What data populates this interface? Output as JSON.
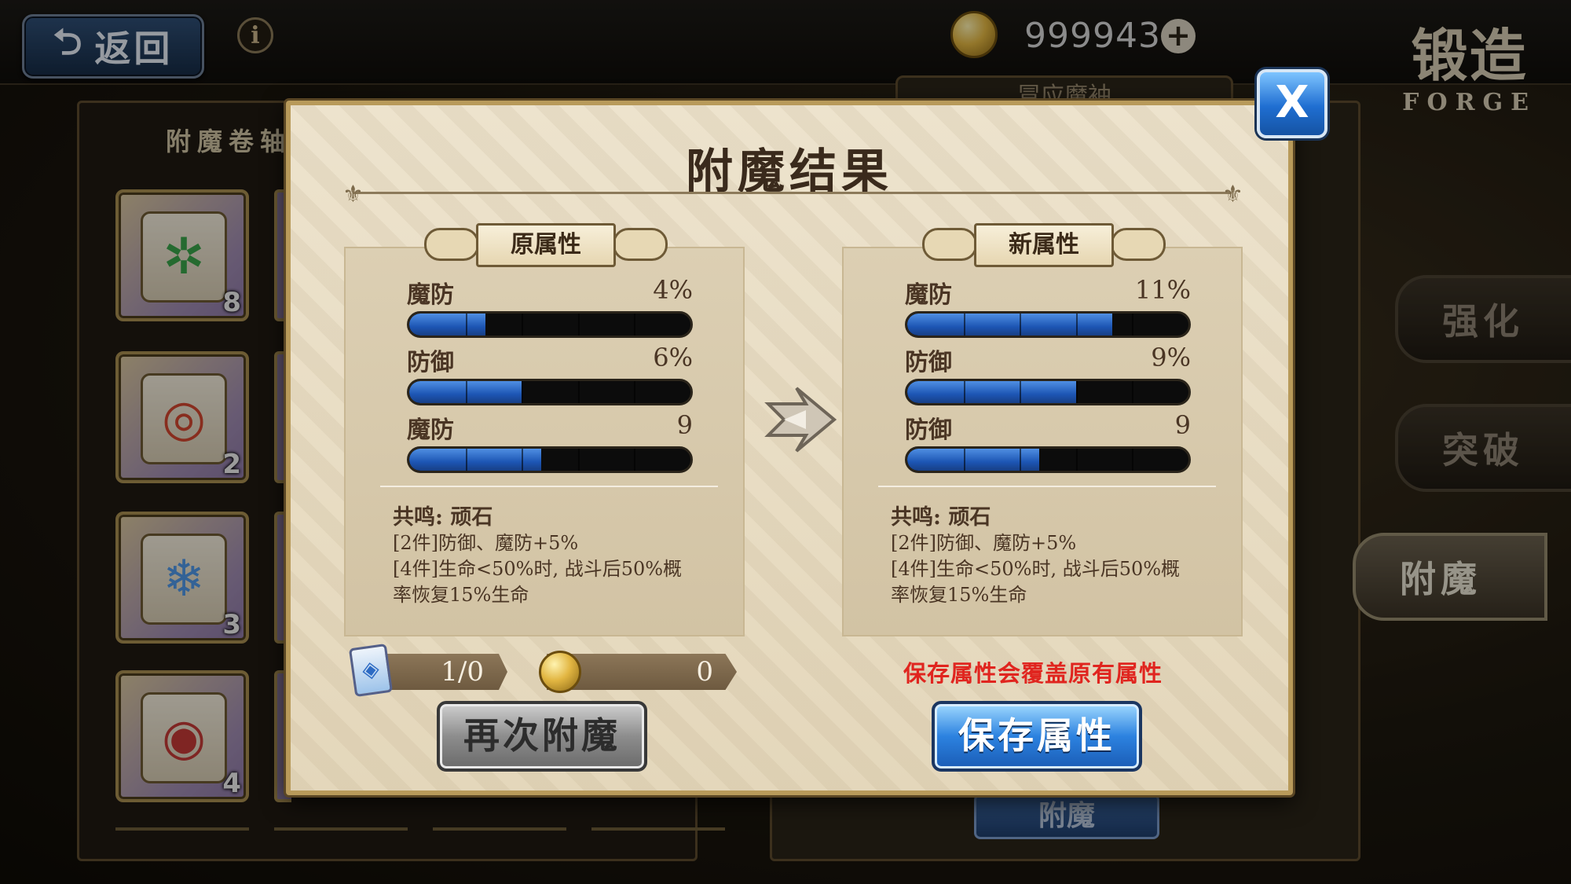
{
  "header": {
    "back_label": "返回",
    "info_icon": "i",
    "coins": "999943",
    "coin_add": "+",
    "screen_title": "锻造",
    "screen_title_en": "FORGE"
  },
  "left_panel": {
    "title": "附魔卷轴",
    "scrolls": [
      {
        "count": "8",
        "color": "#3aa34a",
        "glyph": "✲"
      },
      {
        "count": "2",
        "color": "#d2452e",
        "glyph": "◎"
      },
      {
        "count": "3",
        "color": "#4f97e6",
        "glyph": "❄"
      },
      {
        "count": "4",
        "color": "#c43a36",
        "glyph": "◉"
      }
    ]
  },
  "right_panel": {
    "tab_label": "冒应魔袖",
    "side_tabs": [
      "强化",
      "突破",
      "附魔"
    ],
    "bg_button": "附魔"
  },
  "modal": {
    "title": "附魔结果",
    "close_label": "X",
    "old": {
      "banner": "原属性",
      "stats": [
        {
          "name": "魔防",
          "value": "4%",
          "fill": 0.27
        },
        {
          "name": "防御",
          "value": "6%",
          "fill": 0.4
        },
        {
          "name": "魔防",
          "value": "9",
          "fill": 0.47
        }
      ],
      "resonance_title": "共鸣: 顽石",
      "resonance_lines": [
        "[2件]防御、魔防+5%",
        "[4件]生命<50%时, 战斗后50%概",
        "率恢复15%生命"
      ]
    },
    "new": {
      "banner": "新属性",
      "stats": [
        {
          "name": "魔防",
          "value": "11%",
          "fill": 0.73
        },
        {
          "name": "防御",
          "value": "9%",
          "fill": 0.6
        },
        {
          "name": "防御",
          "value": "9",
          "fill": 0.47
        }
      ],
      "resonance_title": "共鸣: 顽石",
      "resonance_lines": [
        "[2件]防御、魔防+5%",
        "[4件]生命<50%时, 战斗后50%概",
        "率恢复15%生命"
      ]
    },
    "cost_scroll": "1/0",
    "cost_gold": "0",
    "warning": "保存属性会覆盖原有属性",
    "reroll_button": "再次附魔",
    "save_button": "保存属性"
  }
}
